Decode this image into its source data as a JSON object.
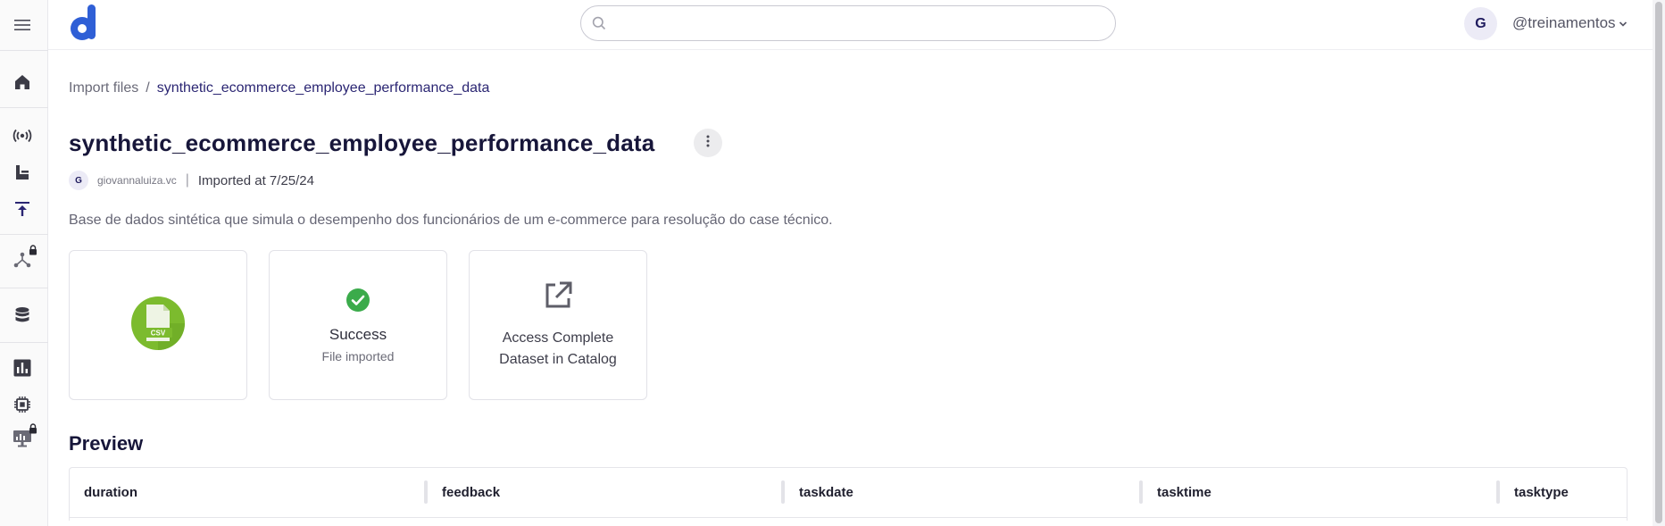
{
  "header": {
    "search": {
      "value": "",
      "placeholder": ""
    },
    "user": {
      "avatar_initial": "G",
      "name": "@treinamentos"
    }
  },
  "sidebar": {
    "items": [
      {
        "name": "menu",
        "icon": "hamburger-icon"
      },
      {
        "name": "home",
        "icon": "home-icon"
      },
      {
        "name": "broadcast",
        "icon": "antenna-icon"
      },
      {
        "name": "ingestion",
        "icon": "ingest-icon"
      },
      {
        "name": "import",
        "icon": "upload-icon",
        "active": true
      },
      {
        "name": "pipelines",
        "icon": "network-icon",
        "locked": true
      },
      {
        "name": "database",
        "icon": "database-icon"
      },
      {
        "name": "analytics",
        "icon": "bar-chart-icon"
      },
      {
        "name": "processing",
        "icon": "chip-icon"
      },
      {
        "name": "dashboards",
        "icon": "monitor-icon",
        "locked": true
      }
    ]
  },
  "breadcrumb": {
    "parent": "Import files",
    "separator": "/",
    "current": "synthetic_ecommerce_employee_performance_data"
  },
  "page": {
    "title": "synthetic_ecommerce_employee_performance_data",
    "author_initial": "G",
    "author": "giovannaluiza.vc",
    "meta_separator": "|",
    "imported": "Imported at 7/25/24",
    "description": "Base de dados sintética que simula o desempenho dos funcionários de um e-commerce para resolução do case técnico."
  },
  "cards": {
    "file_badge": "CSV",
    "status_title": "Success",
    "status_sub": "File imported",
    "catalog_line1": "Access Complete",
    "catalog_line2": "Dataset in Catalog"
  },
  "preview": {
    "title": "Preview",
    "columns": [
      "duration",
      "feedback",
      "taskdate",
      "tasktime",
      "tasktype"
    ]
  },
  "colors": {
    "accent": "#2b2673",
    "logo": "#2f5fd6",
    "success": "#3bab4b",
    "csv_green": "#7cbb2e"
  }
}
